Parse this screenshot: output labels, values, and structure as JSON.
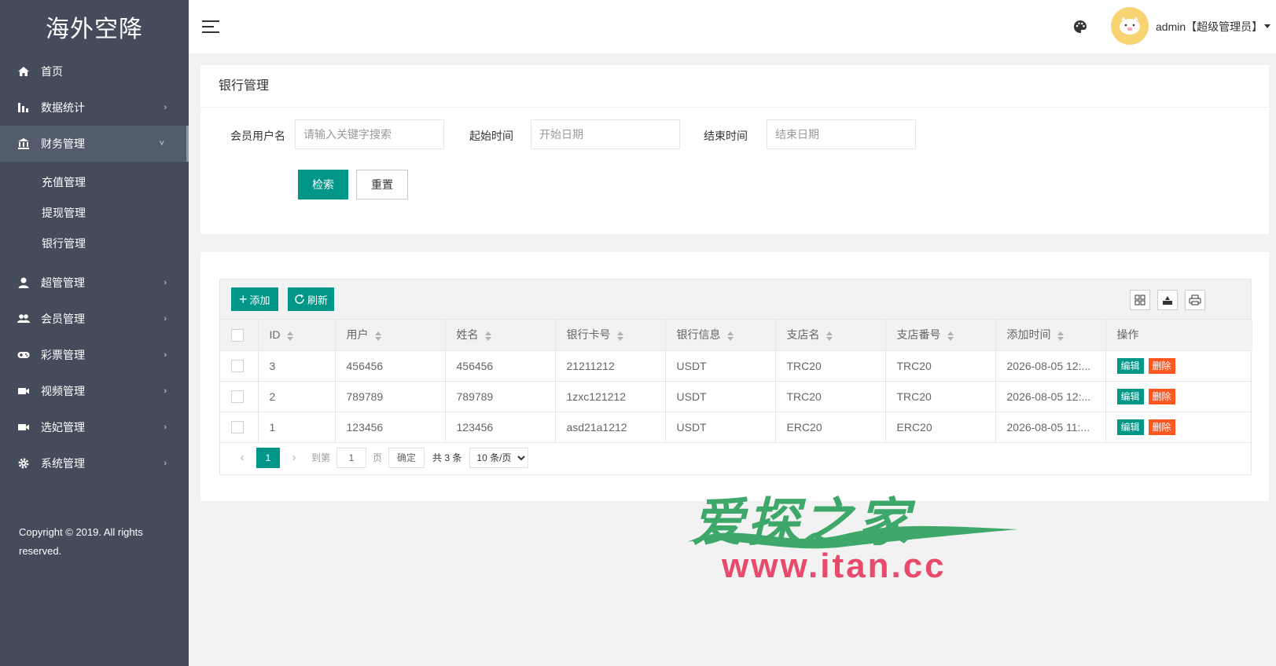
{
  "app": {
    "logo": "海外空降"
  },
  "sidebar": {
    "items": [
      {
        "label": "首页",
        "icon": "home-icon"
      },
      {
        "label": "数据统计",
        "icon": "bar-chart-icon",
        "arrow": "›"
      },
      {
        "label": "财务管理",
        "icon": "bank-icon",
        "arrow": "˅",
        "active": true
      },
      {
        "label": "超管管理",
        "icon": "user-icon",
        "arrow": "›"
      },
      {
        "label": "会员管理",
        "icon": "users-icon",
        "arrow": "›"
      },
      {
        "label": "彩票管理",
        "icon": "gamepad-icon",
        "arrow": "›"
      },
      {
        "label": "视频管理",
        "icon": "video-icon",
        "arrow": "›"
      },
      {
        "label": "选妃管理",
        "icon": "video-icon",
        "arrow": "›"
      },
      {
        "label": "系统管理",
        "icon": "gear-icon",
        "arrow": "›"
      }
    ],
    "sub_items": [
      "充值管理",
      "提现管理",
      "银行管理"
    ],
    "copyright": "Copyright © 2019. All rights reserved."
  },
  "header": {
    "user": "admin【超级管理员】"
  },
  "search": {
    "title": "银行管理",
    "fields": [
      {
        "label": "会员用户名",
        "placeholder": "请输入关键字搜索"
      },
      {
        "label": "起始时间",
        "placeholder": "开始日期"
      },
      {
        "label": "结束时间",
        "placeholder": "结束日期"
      }
    ],
    "search_button": "检索",
    "reset_button": "重置"
  },
  "toolbar": {
    "add": "添加",
    "refresh": "刷新"
  },
  "table": {
    "columns": [
      "ID",
      "用户",
      "姓名",
      "银行卡号",
      "银行信息",
      "支店名",
      "支店番号",
      "添加时间",
      "操作"
    ],
    "rows": [
      [
        "3",
        "456456",
        "456456",
        "21211212",
        "USDT",
        "TRC20",
        "TRC20",
        "2026-08-05 12:..."
      ],
      [
        "2",
        "789789",
        "789789",
        "1zxc121212",
        "USDT",
        "TRC20",
        "TRC20",
        "2026-08-05 12:..."
      ],
      [
        "1",
        "123456",
        "123456",
        "asd21a1212",
        "USDT",
        "ERC20",
        "ERC20",
        "2026-08-05 11:..."
      ]
    ],
    "edit_label": "编辑",
    "delete_label": "删除"
  },
  "pager": {
    "current": "1",
    "goto_label": "到第",
    "goto_value": "1",
    "page_label": "页",
    "confirm": "确定",
    "total": "共 3 条",
    "page_size": "10 条/页"
  },
  "watermark": {
    "line1": "爱探之家",
    "line2": "www.itan.cc"
  },
  "colors": {
    "sidebar": "#444c5c",
    "accent": "#009688",
    "danger": "#ff5722"
  }
}
